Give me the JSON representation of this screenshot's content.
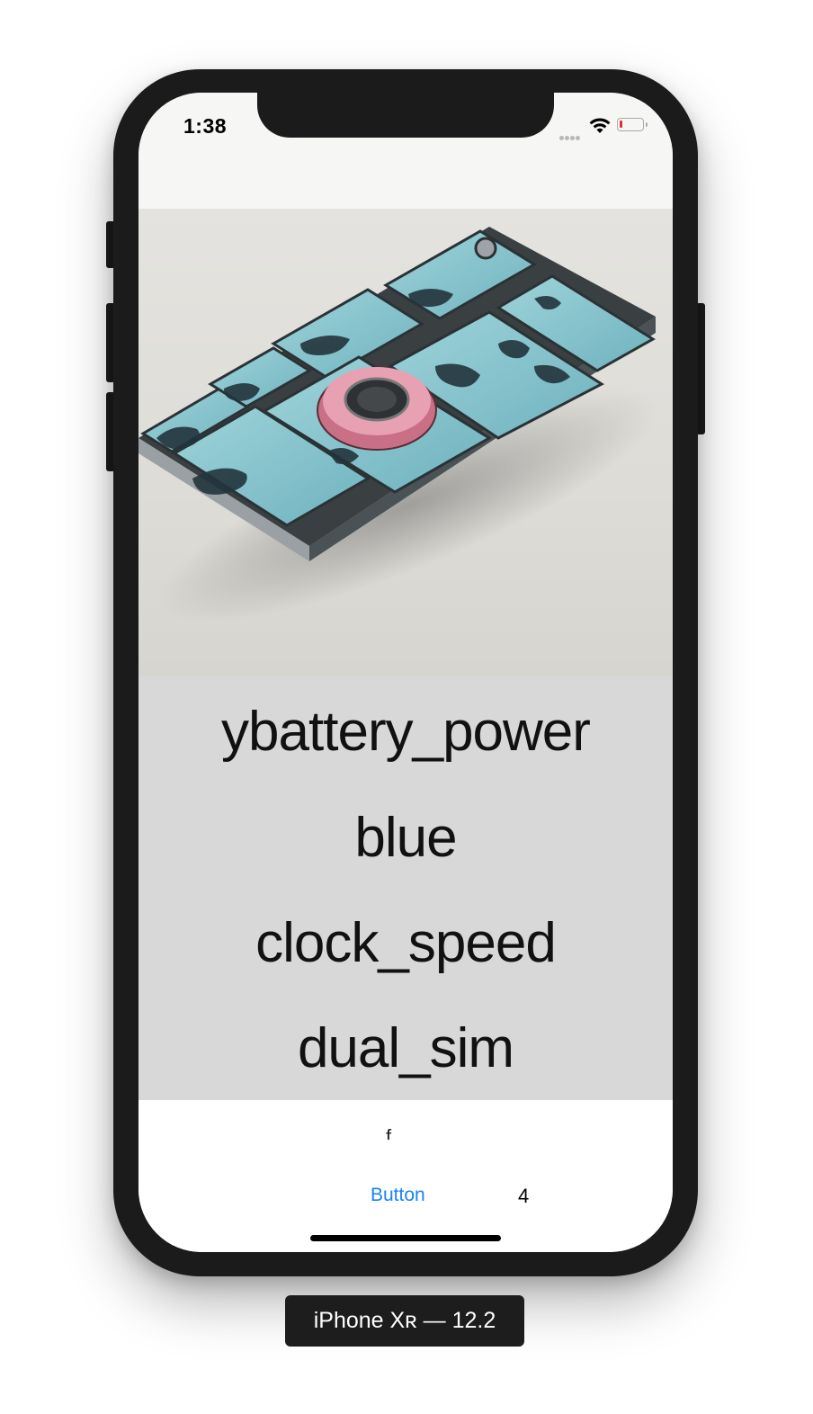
{
  "status_bar": {
    "time": "1:38"
  },
  "picker": {
    "rows": [
      "ybattery_power",
      "blue",
      "clock_speed",
      "dual_sim"
    ]
  },
  "bottom": {
    "button_label": "Button",
    "count": "4"
  },
  "device_label": "iPhone Xʀ — 12.2",
  "colors": {
    "accent": "#1a82f7",
    "picker_bg": "#d8d8d8",
    "navbar_bg": "#f6f6f4"
  },
  "icons": [
    "cellular-signal-icon",
    "wifi-icon",
    "battery-low-icon"
  ]
}
